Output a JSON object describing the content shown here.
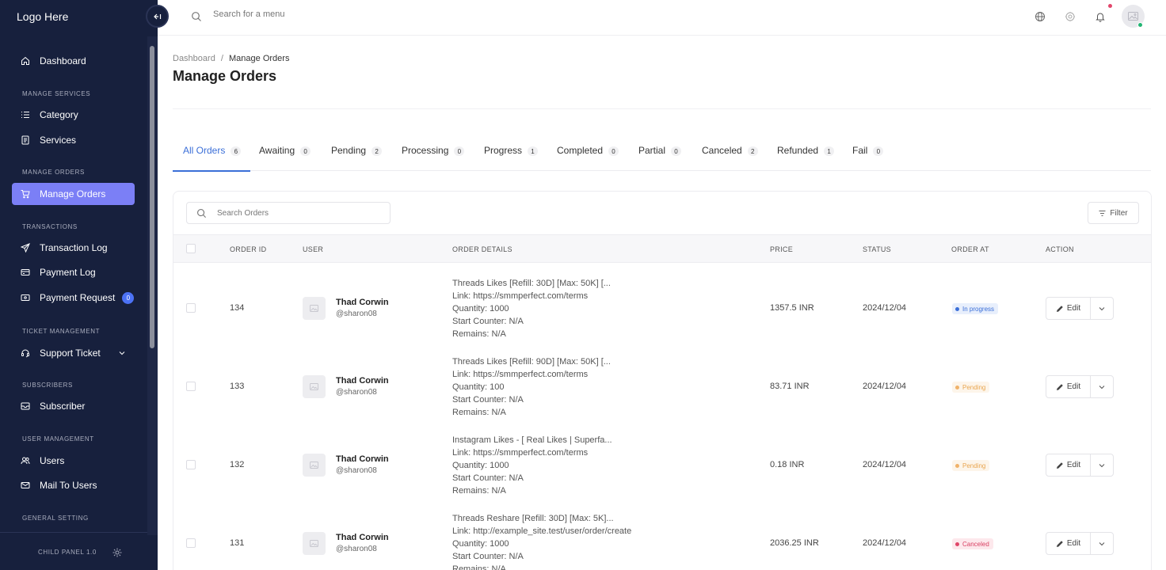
{
  "sidebar": {
    "logo": "Logo Here",
    "dashboard": "Dashboard",
    "sec_services": "MANAGE SERVICES",
    "category": "Category",
    "services": "Services",
    "sec_orders": "MANAGE ORDERS",
    "manage_orders": "Manage Orders",
    "sec_transactions": "TRANSACTIONS",
    "transaction_log": "Transaction Log",
    "payment_log": "Payment Log",
    "payment_request": "Payment Request",
    "payment_request_badge": "0",
    "sec_ticket": "TICKET MANAGEMENT",
    "support_ticket": "Support Ticket",
    "sec_subscribers": "SUBSCRIBERS",
    "subscriber": "Subscriber",
    "sec_users": "USER MANAGEMENT",
    "users": "Users",
    "mail_users": "Mail To Users",
    "sec_general": "GENERAL SETTING",
    "version": "CHILD PANEL 1.0",
    "accent": "#7b7ff6",
    "background": "#17203d"
  },
  "topbar": {
    "search_placeholder": "Search for a menu"
  },
  "breadcrumb": {
    "root": "Dashboard",
    "sep": "/",
    "current": "Manage Orders"
  },
  "page_title": "Manage Orders",
  "tabs": [
    {
      "label": "All Orders",
      "count": "6"
    },
    {
      "label": "Awaiting",
      "count": "0"
    },
    {
      "label": "Pending",
      "count": "2"
    },
    {
      "label": "Processing",
      "count": "0"
    },
    {
      "label": "Progress",
      "count": "1"
    },
    {
      "label": "Completed",
      "count": "0"
    },
    {
      "label": "Partial",
      "count": "0"
    },
    {
      "label": "Canceled",
      "count": "2"
    },
    {
      "label": "Refunded",
      "count": "1"
    },
    {
      "label": "Fail",
      "count": "0"
    }
  ],
  "table": {
    "search_placeholder": "Search Orders",
    "filter_label": "Filter",
    "headers": [
      "ORDER ID",
      "USER",
      "ORDER DETAILS",
      "PRICE",
      "STATUS",
      "ORDER AT",
      "ACTION"
    ],
    "edit_label": "Edit",
    "rows": [
      {
        "id": "134",
        "user": "Thad Corwin",
        "handle": "@sharon08",
        "d1": "Threads Likes [Refill: 30D] [Max: 50K] [...",
        "d2": "Link: https://smmperfect.com/terms",
        "d3": "Quantity: 1000",
        "d4": "Start Counter: N/A",
        "d5": "Remains: N/A",
        "price": "1357.5 INR",
        "date": "2024/12/04",
        "status": "In progress"
      },
      {
        "id": "133",
        "user": "Thad Corwin",
        "handle": "@sharon08",
        "d1": "Threads Likes [Refill: 90D] [Max: 50K] [...",
        "d2": "Link: https://smmperfect.com/terms",
        "d3": "Quantity: 100",
        "d4": "Start Counter: N/A",
        "d5": "Remains: N/A",
        "price": "83.71 INR",
        "date": "2024/12/04",
        "status": "Pending"
      },
      {
        "id": "132",
        "user": "Thad Corwin",
        "handle": "@sharon08",
        "d1": "Instagram Likes - [ Real Likes | Superfa...",
        "d2": "Link: https://smmperfect.com/terms",
        "d3": "Quantity: 1000",
        "d4": "Start Counter: N/A",
        "d5": "Remains: N/A",
        "price": "0.18 INR",
        "date": "2024/12/04",
        "status": "Pending"
      },
      {
        "id": "131",
        "user": "Thad Corwin",
        "handle": "@sharon08",
        "d1": "Threads Reshare [Refill: 30D] [Max: 5K]...",
        "d2": "Link: http://example_site.test/user/order/create",
        "d3": "Quantity: 1000",
        "d4": "Start Counter: N/A",
        "d5": "Remains: N/A",
        "price": "2036.25 INR",
        "date": "2024/12/04",
        "status": "Canceled"
      }
    ]
  }
}
